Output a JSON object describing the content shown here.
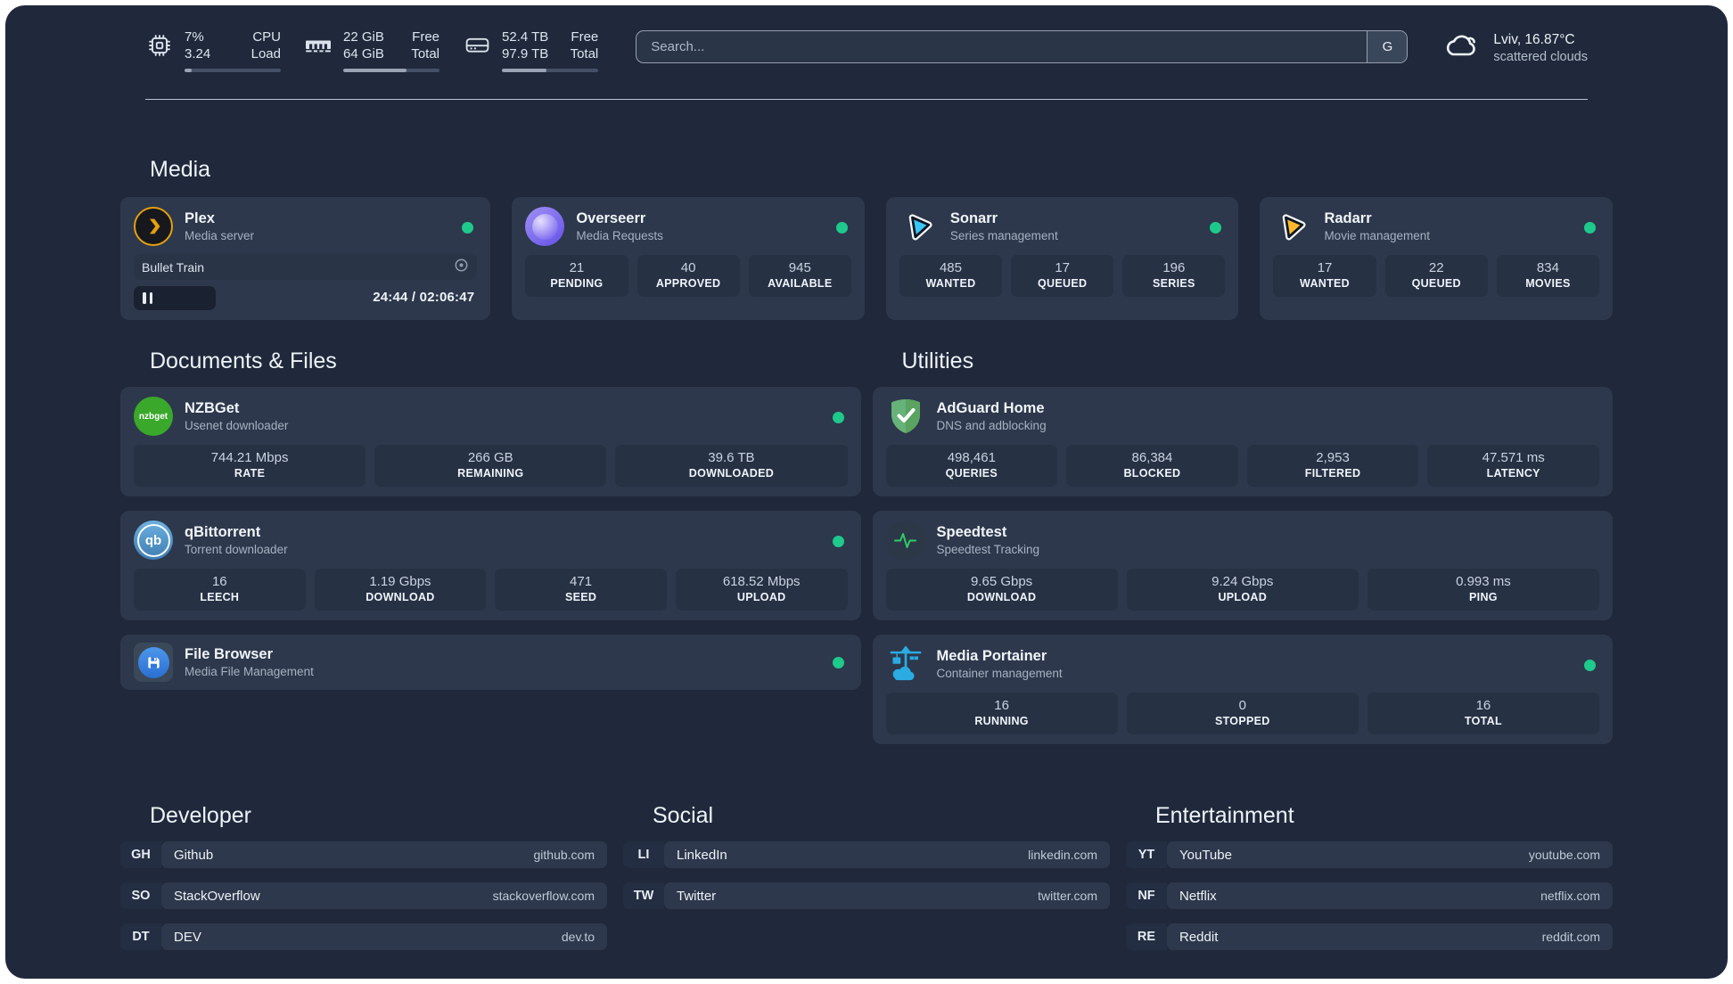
{
  "colors": {
    "background": "#1f293b",
    "card": "#2d384c",
    "tile": "#263144",
    "status_green": "#1ec98c",
    "plex_amber": "#e5a00d",
    "overseerr_purple": "#6450e8",
    "sonarr_cyan": "#38c6f4",
    "radarr_yellow": "#ffb82a",
    "nzbget_green": "#3aa82b",
    "qbittorrent_blue": "#3f7db2",
    "filebrowser_blue": "#2a6fd2",
    "adguard_green": "#63ad69",
    "speedtest_green": "#2ecc66",
    "portainer_blue": "#2aabe2"
  },
  "header": {
    "cpu": {
      "top": "7%",
      "bottom": "3.24",
      "label_top": "CPU",
      "label_bottom": "Load",
      "progress_percent": 7
    },
    "memory": {
      "top": "22 GiB",
      "bottom": "64 GiB",
      "label_top": "Free",
      "label_bottom": "Total",
      "progress_percent": 66
    },
    "disk": {
      "top": "52.4 TB",
      "bottom": "97.9 TB",
      "label_top": "Free",
      "label_bottom": "Total",
      "progress_percent": 46
    },
    "search": {
      "placeholder": "Search...",
      "engine_button": "G"
    },
    "weather": {
      "location": "Lviv, 16.87°C",
      "condition": "scattered clouds"
    }
  },
  "media": {
    "title": "Media",
    "plex": {
      "name": "Plex",
      "subtitle": "Media server",
      "now_playing": "Bullet Train",
      "elapsed_total": "24:44 / 02:06:47",
      "progress_percent": 24
    },
    "overseerr": {
      "name": "Overseerr",
      "subtitle": "Media Requests",
      "stats": [
        {
          "value": "21",
          "label": "PENDING"
        },
        {
          "value": "40",
          "label": "APPROVED"
        },
        {
          "value": "945",
          "label": "AVAILABLE"
        }
      ]
    },
    "sonarr": {
      "name": "Sonarr",
      "subtitle": "Series management",
      "stats": [
        {
          "value": "485",
          "label": "WANTED"
        },
        {
          "value": "17",
          "label": "QUEUED"
        },
        {
          "value": "196",
          "label": "SERIES"
        }
      ]
    },
    "radarr": {
      "name": "Radarr",
      "subtitle": "Movie management",
      "stats": [
        {
          "value": "17",
          "label": "WANTED"
        },
        {
          "value": "22",
          "label": "QUEUED"
        },
        {
          "value": "834",
          "label": "MOVIES"
        }
      ]
    }
  },
  "documents": {
    "title": "Documents & Files",
    "nzbget": {
      "name": "NZBGet",
      "subtitle": "Usenet downloader",
      "icon_text": "nzbget",
      "stats": [
        {
          "value": "744.21 Mbps",
          "label": "RATE"
        },
        {
          "value": "266 GB",
          "label": "REMAINING"
        },
        {
          "value": "39.6 TB",
          "label": "DOWNLOADED"
        }
      ]
    },
    "qbittorrent": {
      "name": "qBittorrent",
      "subtitle": "Torrent downloader",
      "icon_text": "qb",
      "stats": [
        {
          "value": "16",
          "label": "LEECH"
        },
        {
          "value": "1.19 Gbps",
          "label": "DOWNLOAD"
        },
        {
          "value": "471",
          "label": "SEED"
        },
        {
          "value": "618.52 Mbps",
          "label": "UPLOAD"
        }
      ]
    },
    "filebrowser": {
      "name": "File Browser",
      "subtitle": "Media File Management"
    }
  },
  "utilities": {
    "title": "Utilities",
    "adguard": {
      "name": "AdGuard Home",
      "subtitle": "DNS and adblocking",
      "stats": [
        {
          "value": "498,461",
          "label": "QUERIES"
        },
        {
          "value": "86,384",
          "label": "BLOCKED"
        },
        {
          "value": "2,953",
          "label": "FILTERED"
        },
        {
          "value": "47.571 ms",
          "label": "LATENCY"
        }
      ]
    },
    "speedtest": {
      "name": "Speedtest",
      "subtitle": "Speedtest Tracking",
      "stats": [
        {
          "value": "9.65 Gbps",
          "label": "DOWNLOAD"
        },
        {
          "value": "9.24 Gbps",
          "label": "UPLOAD"
        },
        {
          "value": "0.993 ms",
          "label": "PING"
        }
      ]
    },
    "portainer": {
      "name": "Media Portainer",
      "subtitle": "Container management",
      "stats": [
        {
          "value": "16",
          "label": "RUNNING"
        },
        {
          "value": "0",
          "label": "STOPPED"
        },
        {
          "value": "16",
          "label": "TOTAL"
        }
      ]
    }
  },
  "links": {
    "developer": {
      "title": "Developer",
      "items": [
        {
          "tag": "GH",
          "name": "Github",
          "url": "github.com"
        },
        {
          "tag": "SO",
          "name": "StackOverflow",
          "url": "stackoverflow.com"
        },
        {
          "tag": "DT",
          "name": "DEV",
          "url": "dev.to"
        }
      ]
    },
    "social": {
      "title": "Social",
      "items": [
        {
          "tag": "LI",
          "name": "LinkedIn",
          "url": "linkedin.com"
        },
        {
          "tag": "TW",
          "name": "Twitter",
          "url": "twitter.com"
        }
      ]
    },
    "entertainment": {
      "title": "Entertainment",
      "items": [
        {
          "tag": "YT",
          "name": "YouTube",
          "url": "youtube.com"
        },
        {
          "tag": "NF",
          "name": "Netflix",
          "url": "netflix.com"
        },
        {
          "tag": "RE",
          "name": "Reddit",
          "url": "reddit.com"
        }
      ]
    }
  }
}
